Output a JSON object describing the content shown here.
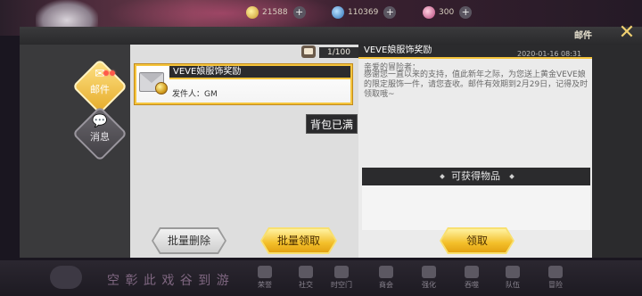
{
  "hud": {
    "gold": "21588",
    "crystal": "110369",
    "gem": "300",
    "bottom_banner": "空 彰 此 戏 谷 到 游"
  },
  "window": {
    "title": "邮件",
    "close_glyph": "✕"
  },
  "tabs": [
    {
      "label": "邮件",
      "icon": "mail-icon",
      "active": true
    },
    {
      "label": "消息",
      "icon": "chat-icon",
      "active": false
    }
  ],
  "mailbox": {
    "count": "1/100",
    "items": [
      {
        "title": "VEVE娘服饰奖励",
        "sender": "发件人：GM"
      }
    ],
    "bag_full": "背包已满"
  },
  "detail": {
    "title": "VEVE娘服饰奖励",
    "date": "2020-01-16  08:31",
    "greeting": "亲爱的冒险者：",
    "body": "感谢您一直以来的支持，值此新年之际，为您送上黄金VEVE娘的限定服饰一件，请您查收。邮件有效期到2月29日，记得及时领取哦~",
    "rewards_label": "可获得物品"
  },
  "buttons": {
    "batch_delete": "批量删除",
    "batch_claim": "批量领取",
    "claim": "领取"
  },
  "bottom_nav": [
    "荣誉",
    "社交",
    "时空门",
    "商会",
    "强化",
    "吞噬",
    "队伍",
    "冒险"
  ],
  "colors": {
    "accent_gold": "#f5c43c",
    "panel_dark": "#2b2b2d",
    "panel_light": "#ebebeb"
  }
}
